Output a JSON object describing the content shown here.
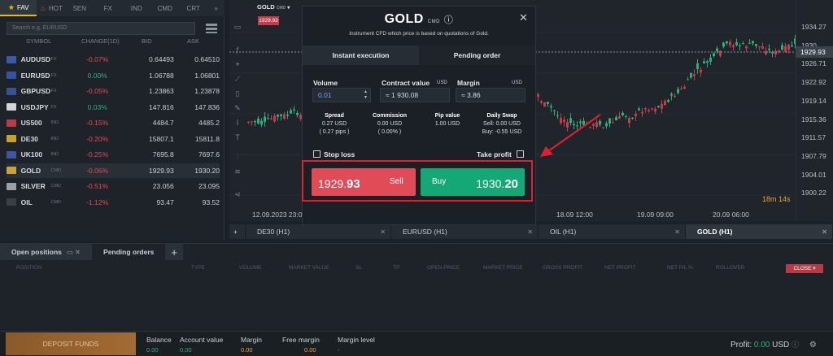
{
  "watchlist": {
    "tabs": [
      {
        "label": "FAV",
        "icon": "star-icon"
      },
      {
        "label": "HOT",
        "icon": "flame-icon"
      },
      {
        "label": "SEN"
      },
      {
        "label": "FX"
      },
      {
        "label": "IND"
      },
      {
        "label": "CMD"
      },
      {
        "label": "CRT"
      }
    ],
    "more": "»",
    "search_placeholder": "Search e.g. EURUSD",
    "headers": {
      "symbol": "SYMBOL",
      "change": "CHANGE(1D)",
      "bid": "BID",
      "ask": "ASK"
    },
    "rows": [
      {
        "symbol": "AUDUSD",
        "tag": "FX",
        "change": "-0.07%",
        "bid": "0.64493",
        "ask": "0.64510",
        "trend": "neg",
        "flag": "#3b5aa8"
      },
      {
        "symbol": "EURUSD",
        "tag": "FX",
        "change": "0.00%",
        "bid": "1.06788",
        "ask": "1.06801",
        "trend": "pos",
        "flag": "#3354a6"
      },
      {
        "symbol": "GBPUSD",
        "tag": "FX",
        "change": "-0.05%",
        "bid": "1.23863",
        "ask": "1.23878",
        "trend": "neg",
        "flag": "#3b4f95"
      },
      {
        "symbol": "USDJPY",
        "tag": "FX",
        "change": "0.03%",
        "bid": "147.816",
        "ask": "147.836",
        "trend": "pos",
        "flag": "#d4d4d8"
      },
      {
        "symbol": "US500",
        "tag": "IND",
        "change": "-0.15%",
        "bid": "4484.7",
        "ask": "4485.2",
        "trend": "neg",
        "flag": "#b83b47"
      },
      {
        "symbol": "DE30",
        "tag": "IND",
        "change": "-0.20%",
        "bid": "15807.1",
        "ask": "15811.8",
        "trend": "neg",
        "flag": "#c7a12e"
      },
      {
        "symbol": "UK100",
        "tag": "IND",
        "change": "-0.25%",
        "bid": "7695.8",
        "ask": "7697.6",
        "trend": "neg",
        "flag": "#4056a0"
      },
      {
        "symbol": "GOLD",
        "tag": "CMD",
        "change": "-0.06%",
        "bid": "1929.93",
        "ask": "1930.20",
        "trend": "neg",
        "flag": "#c9a23a"
      },
      {
        "symbol": "SILVER",
        "tag": "CMD",
        "change": "-0.51%",
        "bid": "23.056",
        "ask": "23.095",
        "trend": "neg",
        "flag": "#9aa0a6"
      },
      {
        "symbol": "OIL",
        "tag": "CMD",
        "change": "-1.12%",
        "bid": "93.47",
        "ask": "93.52",
        "trend": "neg",
        "flag": "#3a3f45"
      }
    ]
  },
  "chart": {
    "symbol": "GOLD",
    "symbol_tag": "CMD",
    "badge": "1929.93",
    "current_price": "1929.93",
    "timer": "18m 14s",
    "yticks": [
      "1934.27",
      "1930.",
      "1926.71",
      "1922.92",
      "1919.14",
      "1915.36",
      "1911.57",
      "1907.79",
      "1904.01",
      "1900.22"
    ],
    "xticks": [
      "12.09.2023 23:00",
      "13.09 20:00",
      "14.09 17:00",
      "15.09 14:00",
      "18.09 12:00",
      "19.09 09:00",
      "20.09 06:00"
    ]
  },
  "chart_tabs": [
    {
      "label": "DE30 (H1)"
    },
    {
      "label": "EURUSD (H1)"
    },
    {
      "label": "OIL (H1)"
    },
    {
      "label": "GOLD (H1)",
      "active": true
    }
  ],
  "chart_tab_add": "+",
  "modal": {
    "title": "GOLD",
    "title_tag": "CMD",
    "subtitle": "Instrument CFD which price is based on quotations of Gold.",
    "tabs": [
      "Instant execution",
      "Pending order"
    ],
    "volume_label": "Volume",
    "volume_value": "0.01",
    "contract_label": "Contract value",
    "contract_unit": "USD",
    "contract_value": "≈ 1 930.08",
    "margin_label": "Margin",
    "margin_unit": "USD",
    "margin_value": "≈ 3.86",
    "spread_label": "Spread",
    "spread_l1": "0.27 USD",
    "spread_l2": "( 0.27 pips )",
    "commission_label": "Commission",
    "commission_l1": "0.00 USD",
    "commission_l2": "( 0.00% )",
    "pip_label": "Pip value",
    "pip_l1": "1.00 USD",
    "swap_label": "Daily Swap",
    "swap_l1": "Sell: 0.00 USD",
    "swap_l2": "Buy: -0.55 USD",
    "stop_loss": "Stop loss",
    "take_profit": "Take profit",
    "sell_price_main": "1929.",
    "sell_price_big": "93",
    "sell_label": "Sell",
    "buy_label": "Buy",
    "buy_price_main": "1930.",
    "buy_price_big": "20"
  },
  "positions": {
    "tabs": [
      "Open positions",
      "Pending orders"
    ],
    "add": "+",
    "headers": [
      "POSITION",
      "TYPE",
      "VOLUME",
      "MARKET VALUE",
      "SL",
      "TP",
      "OPEN PRICE",
      "MARKET PRICE",
      "GROSS PROFIT",
      "NET PROFIT",
      "NET P/L %",
      "ROLLOVER"
    ],
    "close": "CLOSE"
  },
  "footer": {
    "deposit": "DEPOSIT FUNDS",
    "balance_label": "Balance",
    "balance": "0.00",
    "account_label": "Account value",
    "account": "0.00",
    "margin_label": "Margin",
    "margin": "0.00",
    "free_label": "Free margin",
    "free": "0.00",
    "level_label": "Margin level",
    "level": "-",
    "profit_label": "Profit:",
    "profit_value": "0.00",
    "profit_unit": "USD"
  }
}
